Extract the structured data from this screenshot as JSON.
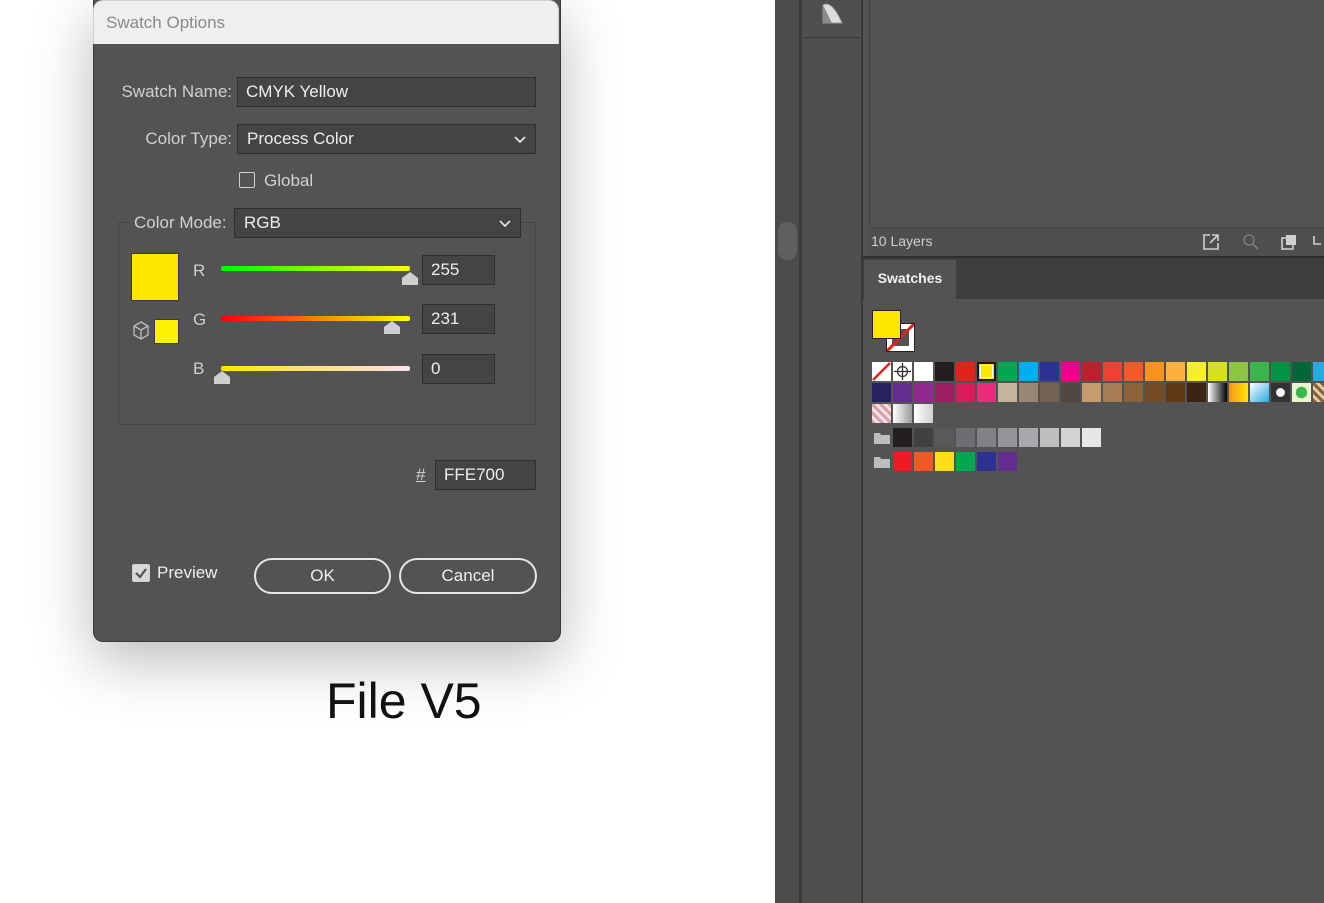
{
  "dialog": {
    "title": "Swatch Options",
    "swatch_name_label": "Swatch Name:",
    "swatch_name_value": "CMYK Yellow",
    "color_type_label": "Color Type:",
    "color_type_value": "Process Color",
    "global_label": "Global",
    "global_checked": false,
    "color_mode_label": "Color Mode:",
    "color_mode_value": "RGB",
    "sliders": [
      {
        "label": "R",
        "value": "255"
      },
      {
        "label": "G",
        "value": "231"
      },
      {
        "label": "B",
        "value": "0"
      }
    ],
    "hex_label": "#",
    "hex_value": "FFE700",
    "preview_label": "Preview",
    "preview_checked": true,
    "ok_label": "OK",
    "cancel_label": "Cancel",
    "current_color": "#FFE700"
  },
  "caption": "File V5",
  "panel": {
    "layers_count": "10 Layers",
    "swatches_tab": "Swatches",
    "fill_color": "#FFE700",
    "swatch_rows": [
      [
        "none",
        "registration",
        "#FFFFFF",
        "#231F20",
        "#E2231A",
        "#FFE700",
        "#00A651",
        "#00AEEF",
        "#2E3192",
        "#EC008C",
        "#BE1E2D",
        "#EF4136",
        "#F15A29",
        "#F7941D",
        "#FBB040",
        "#F9ED32",
        "#D7DF23",
        "#8DC63F",
        "#39B54A",
        "#009444",
        "#006838",
        "#27AAE1"
      ],
      [
        "#262262",
        "#662D91",
        "#92278F",
        "#9E1F63",
        "#DA1C5C",
        "#EE2A7B",
        "#C2B59B",
        "#998675",
        "#736357",
        "#534741",
        "#C69C6D",
        "#A67C52",
        "#8C6239",
        "#754C24",
        "#603913",
        "#3C2415",
        "gradient-bw",
        "gradient-orange",
        "gradient-blue",
        "pattern-dots",
        "pattern-leaf",
        "pattern-brown"
      ],
      [
        "gradient-pink",
        "gradient-gray",
        "gradient-white"
      ]
    ],
    "gray_group": [
      "#231F20",
      "#414042",
      "#58595B",
      "#6D6E71",
      "#808285",
      "#939598",
      "#A7A9AC",
      "#BCBEC0",
      "#D1D3D4",
      "#E6E7E8"
    ],
    "bright_group": [
      "#ED1C24",
      "#F15A24",
      "#FFDE17",
      "#00A651",
      "#2E3192",
      "#662D91"
    ]
  }
}
